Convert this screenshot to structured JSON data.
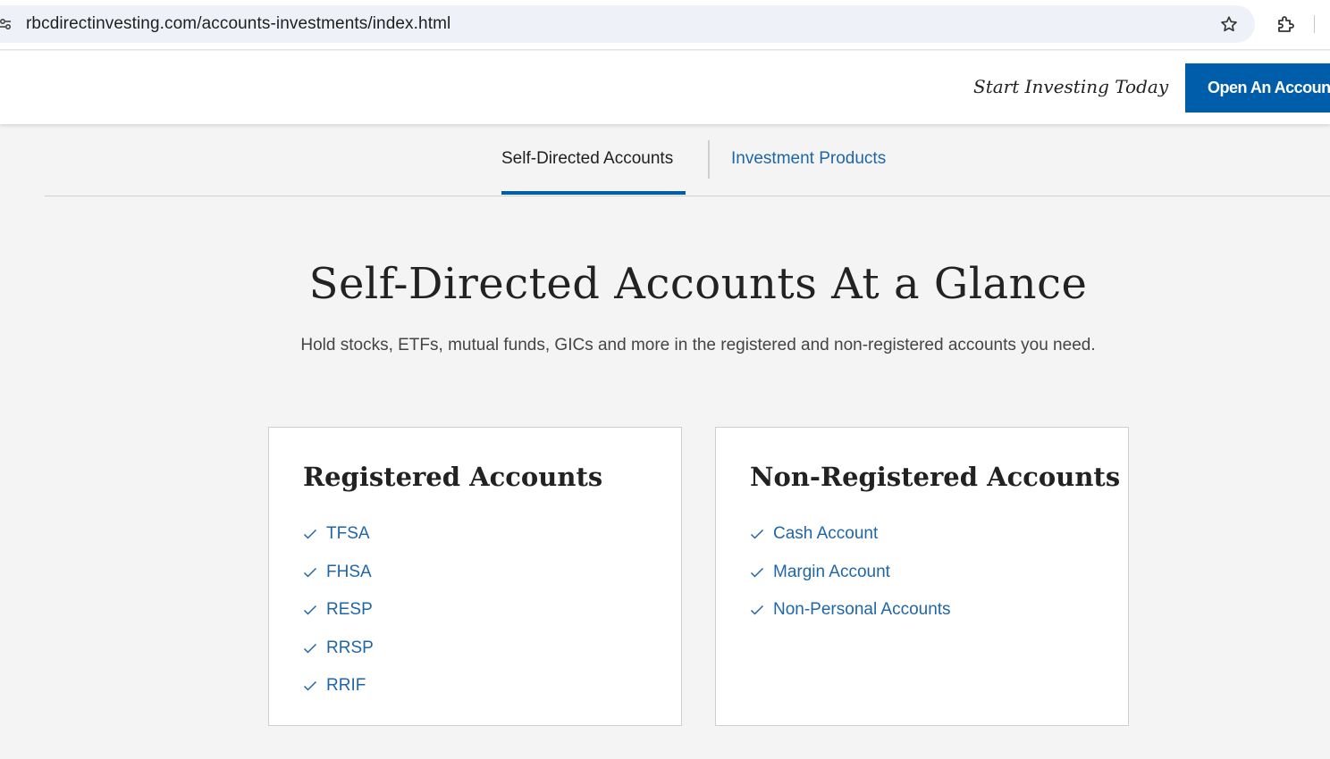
{
  "browser": {
    "url": "rbcdirectinvesting.com/accounts-investments/index.html"
  },
  "header": {
    "tagline": "Start Investing Today",
    "cta_label": "Open An Account"
  },
  "tabs": [
    {
      "label": "Self-Directed Accounts",
      "active": true
    },
    {
      "label": "Investment Products",
      "active": false
    }
  ],
  "hero": {
    "title": "Self-Directed Accounts At a Glance",
    "subtitle": "Hold stocks, ETFs, mutual funds, GICs and more in the registered and non-registered accounts you need."
  },
  "cards": [
    {
      "title": "Registered Accounts",
      "items": [
        "TFSA",
        "FHSA",
        "RESP",
        "RRSP",
        "RRIF"
      ]
    },
    {
      "title": "Non-Registered Accounts",
      "items": [
        "Cash Account",
        "Margin Account",
        "Non-Personal Accounts"
      ]
    }
  ],
  "colors": {
    "brand_blue": "#005daa",
    "link_blue": "#1f66a8",
    "background": "#f4f4f4"
  }
}
